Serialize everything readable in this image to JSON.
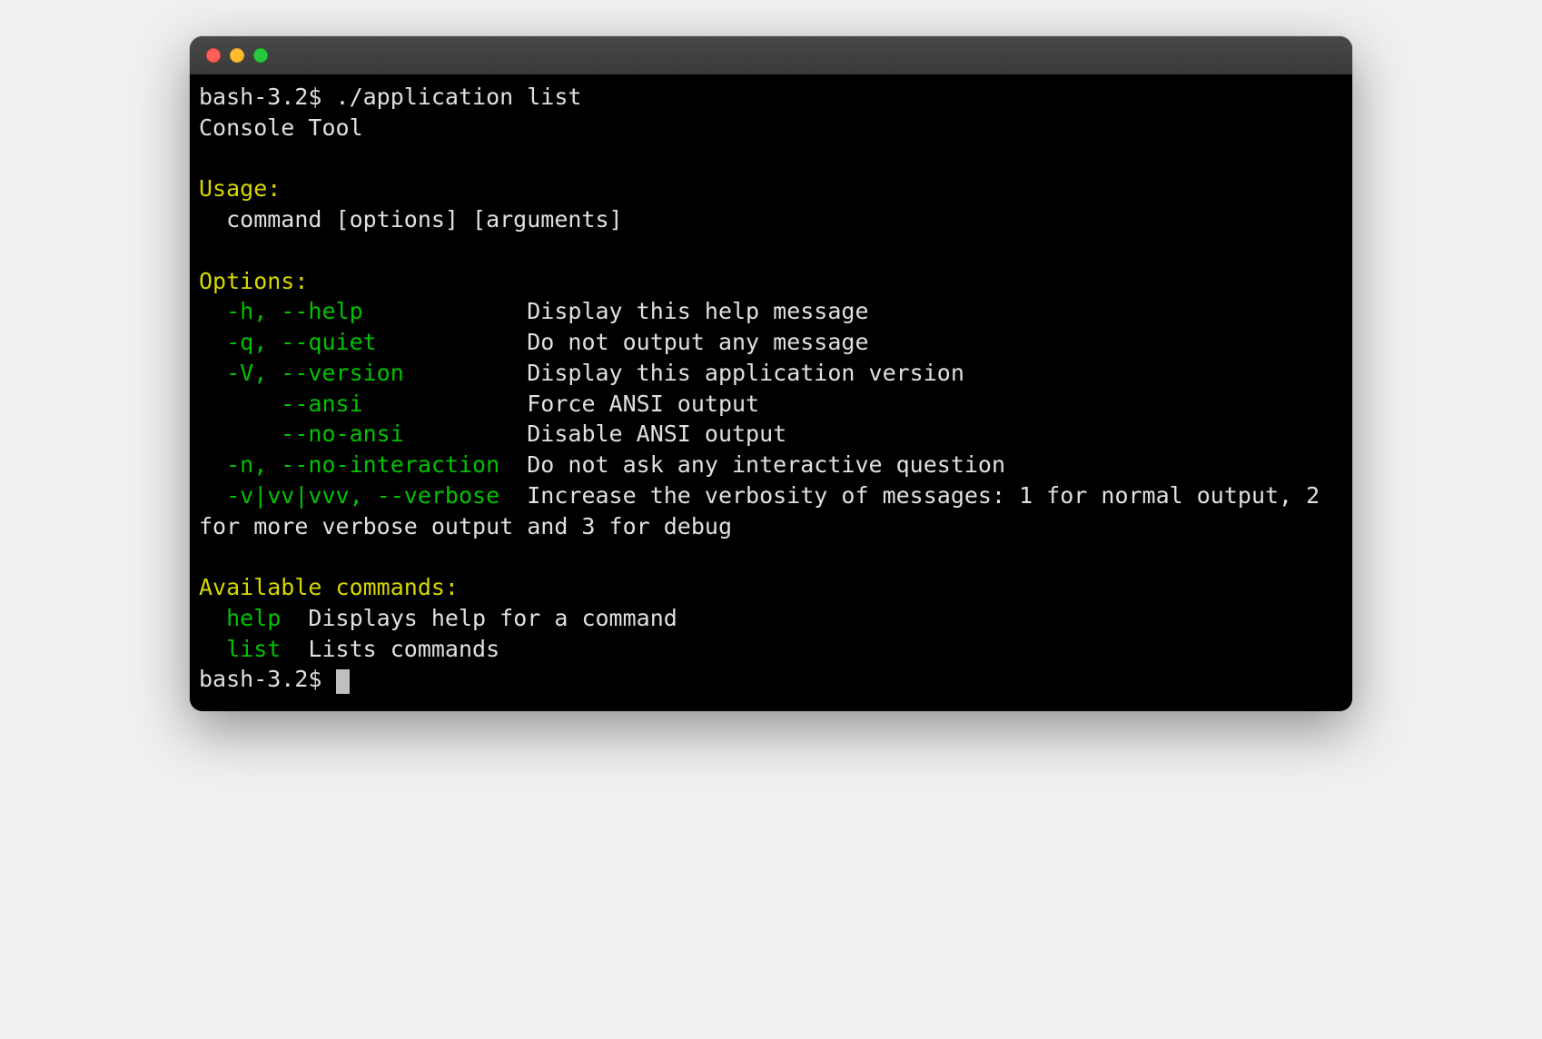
{
  "prompt": {
    "ps1": "bash-3.2$ ",
    "command": "./application list"
  },
  "header": "Console Tool",
  "usage": {
    "heading": "Usage:",
    "line": "  command [options] [arguments]"
  },
  "options": {
    "heading": "Options:",
    "items": [
      {
        "flag": "  -h, --help            ",
        "desc": "Display this help message"
      },
      {
        "flag": "  -q, --quiet           ",
        "desc": "Do not output any message"
      },
      {
        "flag": "  -V, --version         ",
        "desc": "Display this application version"
      },
      {
        "flag": "      --ansi            ",
        "desc": "Force ANSI output"
      },
      {
        "flag": "      --no-ansi         ",
        "desc": "Disable ANSI output"
      },
      {
        "flag": "  -n, --no-interaction  ",
        "desc": "Do not ask any interactive question"
      },
      {
        "flag": "  -v|vv|vvv, --verbose  ",
        "desc": "Increase the verbosity of messages: 1 for normal output, 2 for more verbose output and 3 for debug"
      }
    ]
  },
  "commands": {
    "heading": "Available commands:",
    "items": [
      {
        "name": "  help  ",
        "desc": "Displays help for a command"
      },
      {
        "name": "  list  ",
        "desc": "Lists commands"
      }
    ]
  },
  "prompt2": {
    "ps1": "bash-3.2$ "
  }
}
